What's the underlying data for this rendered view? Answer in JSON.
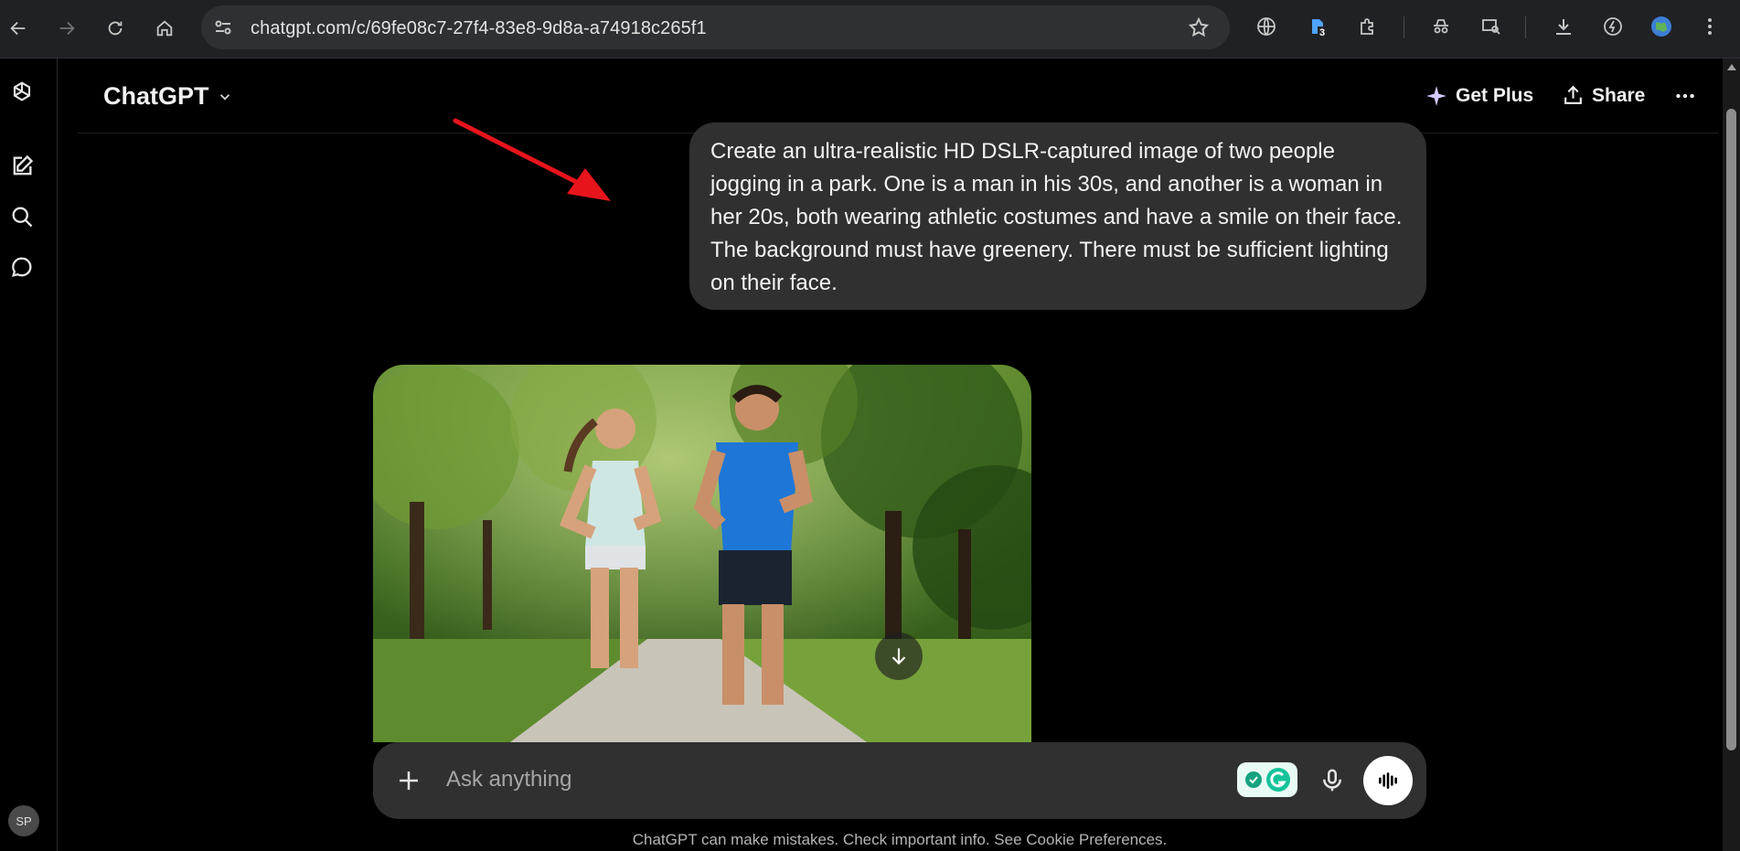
{
  "browser": {
    "url": "chatgpt.com/c/69fe08c7-27f4-83e8-9d8a-a74918c265f1",
    "extension_badge": "3"
  },
  "sidebar": {
    "avatar_initials": "SP"
  },
  "header": {
    "app_title": "ChatGPT",
    "get_plus_label": "Get Plus",
    "share_label": "Share"
  },
  "conversation": {
    "user_message": "Create an ultra-realistic HD DSLR-captured image of two people jogging in a park. One is a man in his 30s, and another is a woman in her 20s, both wearing athletic costumes and have a smile on their face. The background must have greenery. There must be sufficient lighting on their face."
  },
  "composer": {
    "placeholder": "Ask anything"
  },
  "footer": {
    "disclaimer": "ChatGPT can make mistakes. Check important info. See Cookie Preferences."
  },
  "colors": {
    "background": "#000000",
    "bubble": "#303030",
    "annotation_arrow": "#e8141b"
  }
}
